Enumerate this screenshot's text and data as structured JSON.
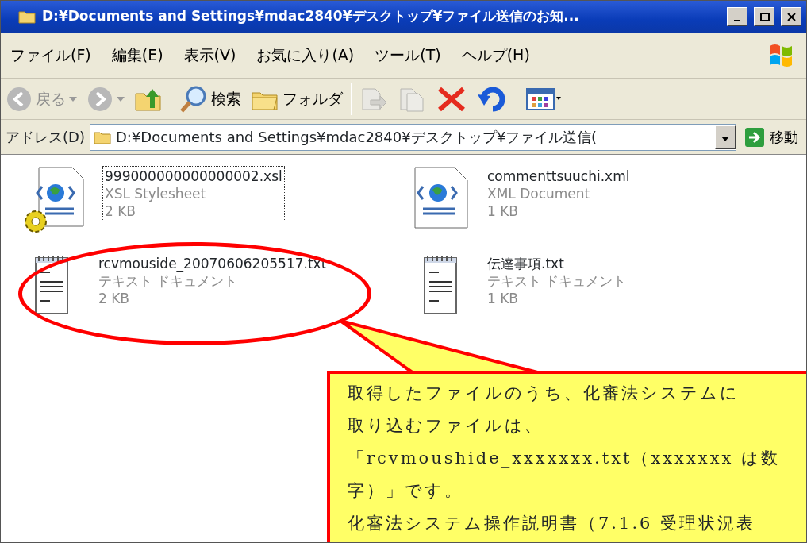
{
  "window": {
    "title": "D:¥Documents and Settings¥mdac2840¥デスクトップ¥ファイル送信のお知..."
  },
  "menu": [
    "ファイル(F)",
    "編集(E)",
    "表示(V)",
    "お気に入り(A)",
    "ツール(T)",
    "ヘルプ(H)"
  ],
  "toolbar": [
    {
      "kind": "back",
      "label": "戻る",
      "disabled": true
    },
    {
      "kind": "forward",
      "disabled": true
    },
    {
      "kind": "up",
      "disabled": false
    },
    {
      "kind": "search",
      "label": "検索",
      "disabled": false
    },
    {
      "kind": "folders",
      "label": "フォルダ",
      "disabled": false
    },
    {
      "kind": "moveto",
      "disabled": true
    },
    {
      "kind": "copyto",
      "disabled": true
    },
    {
      "kind": "delete",
      "disabled": false
    },
    {
      "kind": "undo",
      "disabled": false
    },
    {
      "kind": "views",
      "disabled": false
    }
  ],
  "address": {
    "label": "アドレス(D)",
    "value": "D:¥Documents and Settings¥mdac2840¥デスクトップ¥ファイル送信(",
    "go": "移動"
  },
  "files": [
    {
      "kind": "xsl",
      "name": "999000000000000002.xsl",
      "type": "XSL Stylesheet",
      "size": "2 KB",
      "focused": true
    },
    {
      "kind": "xml",
      "name": "commenttsuuchi.xml",
      "type": "XML Document",
      "size": "1 KB",
      "focused": false
    },
    {
      "kind": "txt",
      "name": "rcvmouside_20070606205517.txt",
      "type": "テキスト ドキュメント",
      "size": "2 KB",
      "focused": false,
      "circled": true
    },
    {
      "kind": "txt",
      "name": "伝達事項.txt",
      "type": "テキスト ドキュメント",
      "size": "1 KB",
      "focused": false,
      "circled": false
    }
  ],
  "callout": {
    "lines": [
      "取得したファイルのうち、化審法システムに",
      "取り込むファイルは、",
      "「rcvmoushide_xxxxxxx.txt（xxxxxxx は数",
      "字）」です。",
      "化審法システム操作説明書（7.1.6 受理状況表"
    ]
  }
}
